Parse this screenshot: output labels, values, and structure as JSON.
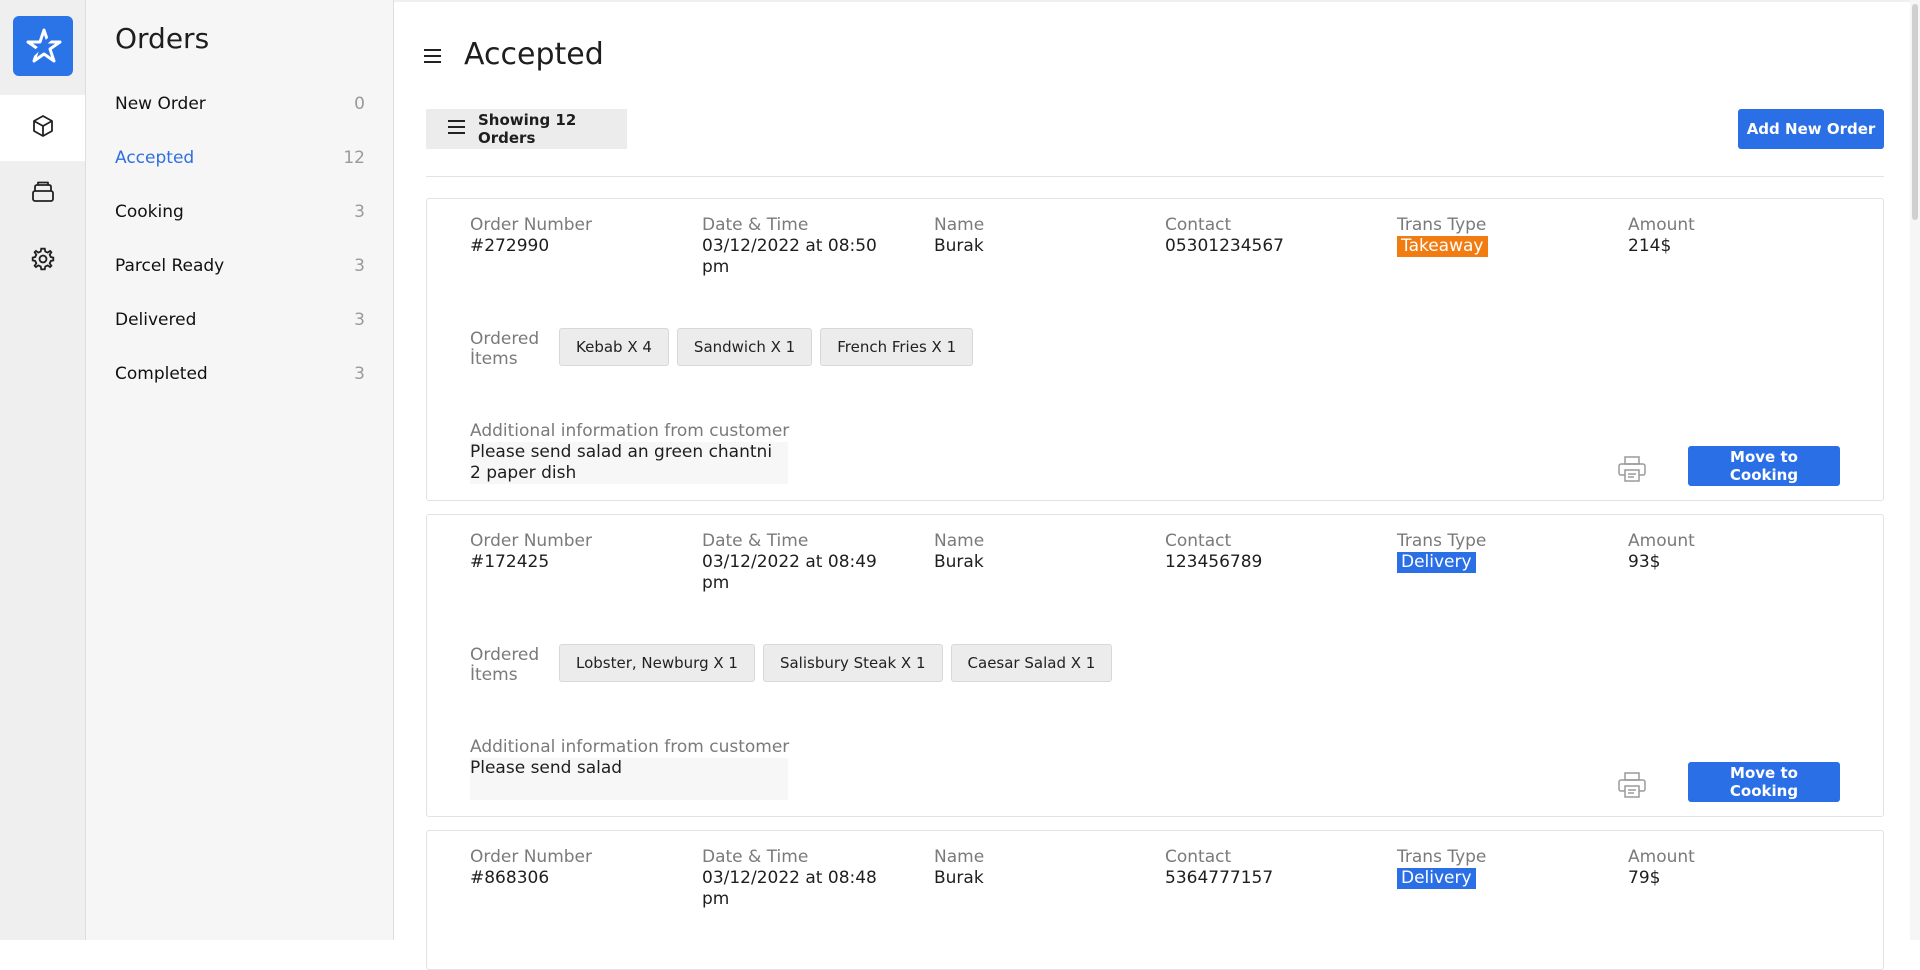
{
  "rail": {
    "logo_icon": "star-logo-icon",
    "items": [
      {
        "icon": "box-icon",
        "active": true
      },
      {
        "icon": "stack-icon",
        "active": false
      },
      {
        "icon": "gear-icon",
        "active": false
      }
    ]
  },
  "sidebar": {
    "title": "Orders",
    "items": [
      {
        "label": "New Order",
        "count": "0"
      },
      {
        "label": "Accepted",
        "count": "12"
      },
      {
        "label": "Cooking",
        "count": "3"
      },
      {
        "label": "Parcel Ready",
        "count": "3"
      },
      {
        "label": "Delivered",
        "count": "3"
      },
      {
        "label": "Completed",
        "count": "3"
      }
    ],
    "active_color": "#2f6fe0"
  },
  "header": {
    "title": "Accepted",
    "showing_label": "Showing 12 Orders",
    "add_button": "Add New Order"
  },
  "labels": {
    "order_number": "Order Number",
    "date_time": "Date & Time",
    "name": "Name",
    "contact": "Contact",
    "trans_type": "Trans Type",
    "amount": "Amount",
    "ordered_items": "Ordered İtems",
    "additional_info": "Additional information from customer",
    "move_button": "Move to Cooking"
  },
  "colors": {
    "primary": "#2b6fe6",
    "takeaway": "#f17c12",
    "delivery": "#2b6fe6"
  },
  "orders": [
    {
      "number": "#272990",
      "datetime": "03/12/2022 at 08:50 pm",
      "name": "Burak",
      "contact": "05301234567",
      "trans_type": "Takeaway",
      "amount": "214$",
      "items": [
        "Kebab X 4",
        "Sandwich X 1",
        "French Fries X 1"
      ],
      "info": "Please send salad an green chantni\n2 paper dish"
    },
    {
      "number": "#172425",
      "datetime": "03/12/2022 at 08:49 pm",
      "name": "Burak",
      "contact": "123456789",
      "trans_type": "Delivery",
      "amount": "93$",
      "items": [
        "Lobster, Newburg X 1",
        "Salisbury Steak X 1",
        "Caesar Salad X 1"
      ],
      "info": "Please send salad"
    },
    {
      "number": "#868306",
      "datetime": "03/12/2022 at 08:48 pm",
      "name": "Burak",
      "contact": "5364777157",
      "trans_type": "Delivery",
      "amount": "79$"
    }
  ]
}
